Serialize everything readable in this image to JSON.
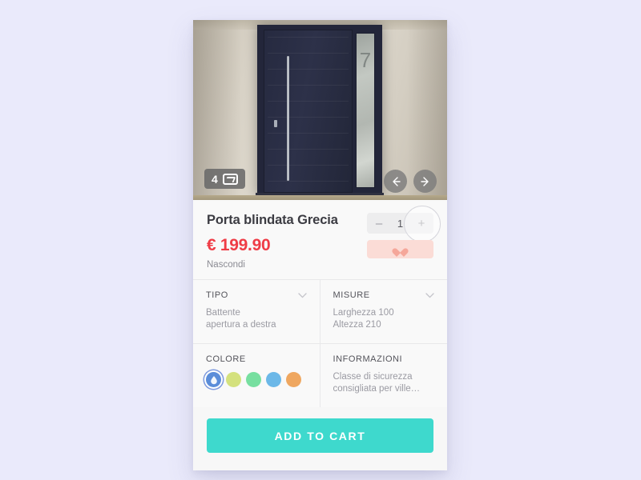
{
  "page": {
    "background_color": "#eaeafb"
  },
  "gallery": {
    "photo_count": "4",
    "photo_icon": "photo-icon",
    "prev_icon": "arrow-left-icon",
    "next_icon": "arrow-right-icon",
    "house_number": "7"
  },
  "product": {
    "title": "Porta blindata Grecia",
    "price": "€ 199.90",
    "price_color": "#ef3c46",
    "hide_label": "Nascondi"
  },
  "quantity": {
    "minus_label": "–",
    "value": "1",
    "plus_label": "+"
  },
  "favorite": {
    "icon": "heart-icon",
    "background_color": "#fbdcd6",
    "heart_color": "#f5a79a"
  },
  "specs": [
    {
      "title": "TIPO",
      "chevron": "chevron-down-icon",
      "body": "Battente\napertura a destra"
    },
    {
      "title": "MISURE",
      "chevron": "chevron-down-icon",
      "body": "Larghezza 100\nAltezza 210"
    },
    {
      "title": "COLORE",
      "chevron": null,
      "body": null
    },
    {
      "title": "INFORMAZIONI",
      "chevron": null,
      "body": "Classe di sicurezza\nconsigliata per ville…"
    }
  ],
  "colors": [
    {
      "name": "blu",
      "hex": "#5b8dd9",
      "selected": true
    },
    {
      "name": "verde-lime",
      "hex": "#d4e17d",
      "selected": false
    },
    {
      "name": "verde-menta",
      "hex": "#77dfa0",
      "selected": false
    },
    {
      "name": "azzurro",
      "hex": "#6cb8e8",
      "selected": false
    },
    {
      "name": "arancione",
      "hex": "#efa760",
      "selected": false
    }
  ],
  "cta": {
    "label": "ADD TO CART",
    "color": "#3ed9cd"
  }
}
